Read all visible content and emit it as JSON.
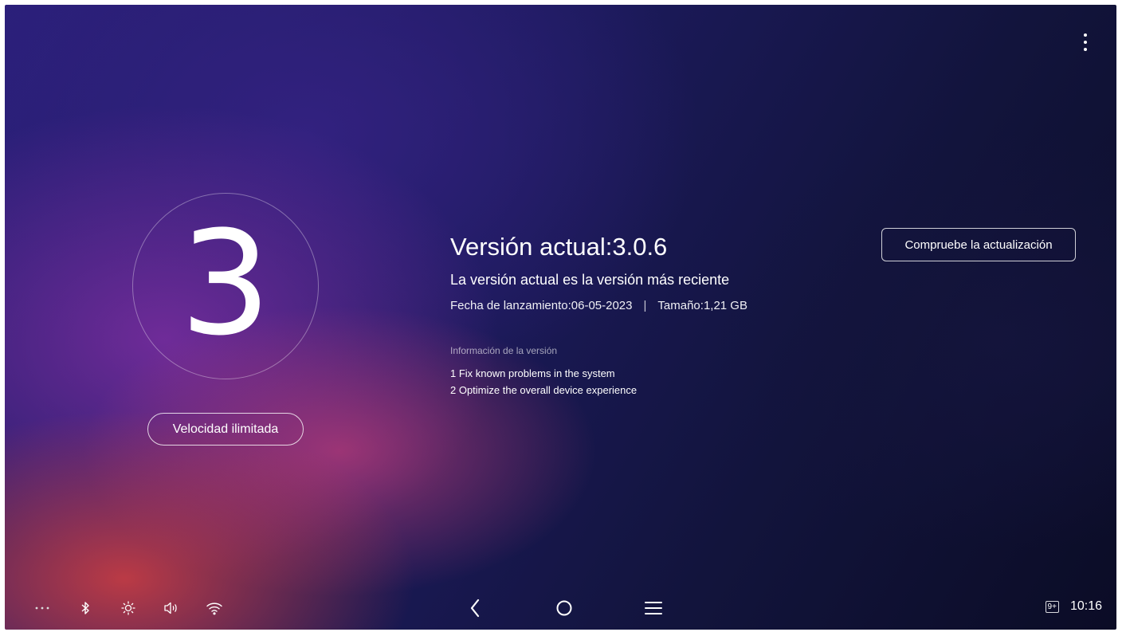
{
  "top_bar": {
    "menu_icon": "more-vert-icon"
  },
  "left_panel": {
    "version_digit": "3",
    "speed_button_label": "Velocidad ilimitada"
  },
  "info": {
    "title": "Versión actual:3.0.6",
    "status": "La versión actual es la versión más reciente",
    "release_date": "Fecha de lanzamiento:06-05-2023",
    "separator": "|",
    "size": "Tamaño:1,21 GB",
    "notes_heading": "Información de la versión",
    "notes": [
      "1 Fix known problems in the system",
      "2 Optimize the overall device experience"
    ]
  },
  "check_button_label": "Compruebe la actualización",
  "nav_bar": {
    "left_icons": [
      "more-horiz-icon",
      "bluetooth-icon",
      "brightness-icon",
      "volume-icon",
      "wifi-icon"
    ],
    "center_icons": [
      "back-icon",
      "home-icon",
      "recents-icon"
    ],
    "notification_badge": "9+",
    "time": "10:16"
  }
}
